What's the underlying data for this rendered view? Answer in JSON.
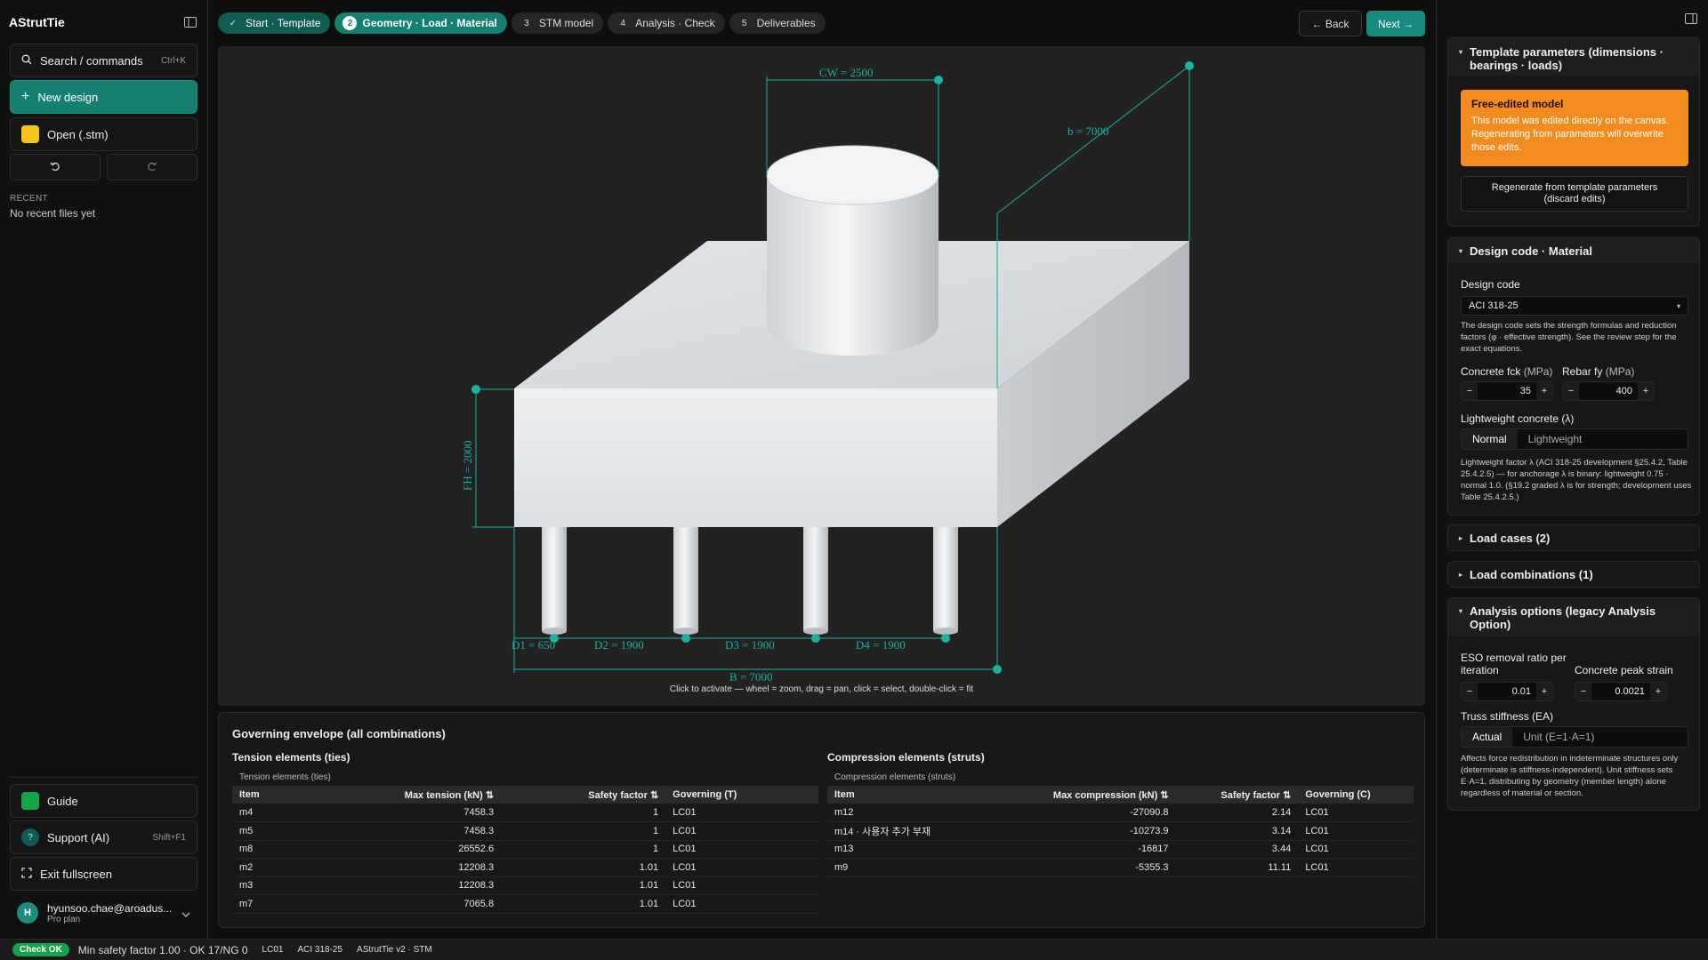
{
  "app": {
    "title": "AStrutTie"
  },
  "sidebar": {
    "search_label": "Search / commands",
    "search_shortcut": "Ctrl+K",
    "new_label": "New design",
    "open_label": "Open (.stm)",
    "recent_heading": "RECENT",
    "recent_empty": "No recent files yet",
    "guide_label": "Guide",
    "support_label": "Support (AI)",
    "support_shortcut": "Shift+F1",
    "fullscreen_label": "Exit fullscreen",
    "user_email": "hyunsoo.chae@aroadus...",
    "user_plan": "Pro plan",
    "user_initial": "H"
  },
  "steps": [
    {
      "num": "✓",
      "label": "Start · Template"
    },
    {
      "num": "2",
      "label": "Geometry · Load · Material"
    },
    {
      "num": "3",
      "label": "STM model"
    },
    {
      "num": "4",
      "label": "Analysis · Check"
    },
    {
      "num": "5",
      "label": "Deliverables"
    }
  ],
  "nav": {
    "back": "← Back",
    "next": "Next →"
  },
  "canvas": {
    "hint": "Click to activate — wheel = zoom, drag = pan, click = select, double-click = fit",
    "dims": {
      "cw": "CW = 2500",
      "b_depth": "b = 7000",
      "fh": "FH = 2000",
      "d1": "D1 = 650",
      "d2": "D2 = 1900",
      "d3": "D3 = 1900",
      "d4": "D4 = 1900",
      "b_width": "B = 7000"
    }
  },
  "results": {
    "title": "Governing envelope (all combinations)",
    "tension": {
      "heading": "Tension elements (ties)",
      "sub": "Tension elements (ties)",
      "cols": [
        "Item",
        "Max tension (kN) ⇅",
        "Safety factor ⇅",
        "Governing (T)"
      ],
      "rows": [
        [
          "m4",
          "7458.3",
          "1",
          "LC01"
        ],
        [
          "m5",
          "7458.3",
          "1",
          "LC01"
        ],
        [
          "m8",
          "26552.6",
          "1",
          "LC01"
        ],
        [
          "m2",
          "12208.3",
          "1.01",
          "LC01"
        ],
        [
          "m3",
          "12208.3",
          "1.01",
          "LC01"
        ],
        [
          "m7",
          "7065.8",
          "1.01",
          "LC01"
        ]
      ]
    },
    "compression": {
      "heading": "Compression elements (struts)",
      "sub": "Compression elements (struts)",
      "cols": [
        "Item",
        "Max compression (kN) ⇅",
        "Safety factor ⇅",
        "Governing (C)"
      ],
      "rows": [
        [
          "m12",
          "-27090.8",
          "2.14",
          "LC01"
        ],
        [
          "m14 · 사용자 추가 부재",
          "-10273.9",
          "3.14",
          "LC01"
        ],
        [
          "m13",
          "-16817",
          "3.44",
          "LC01"
        ],
        [
          "m9",
          "-5355.3",
          "11.11",
          "LC01"
        ]
      ]
    }
  },
  "right": {
    "template": {
      "title": "Template parameters (dimensions · bearings · loads)",
      "warn_title": "Free-edited model",
      "warn_body": "This model was edited directly on the canvas. Regenerating from parameters will overwrite those edits.",
      "regen": "Regenerate from template parameters (discard edits)"
    },
    "design": {
      "title": "Design code · Material",
      "code_label": "Design code",
      "code_value": "ACI 318-25",
      "code_note": "The design code sets the strength formulas and reduction factors (φ · effective strength). See the review step for the exact equations.",
      "fck_label": "Concrete fck",
      "fck_unit": "(MPa)",
      "fck_value": "35",
      "fy_label": "Rebar fy",
      "fy_unit": "(MPa)",
      "fy_value": "400",
      "lw_label": "Lightweight concrete (λ)",
      "lw_opt1": "Normal",
      "lw_opt2": "Lightweight",
      "lw_note": "Lightweight factor λ (ACI 318-25 development §25.4.2, Table 25.4.2.5) — for anchorage λ is binary: lightweight 0.75 · normal 1.0. (§19.2 graded λ is for strength; development uses Table 25.4.2.5.)"
    },
    "load_cases": "Load cases (2)",
    "load_combos": "Load combinations (1)",
    "analysis": {
      "title": "Analysis options (legacy Analysis Option)",
      "eso_label": "ESO removal ratio per iteration",
      "eso_value": "0.01",
      "strain_label": "Concrete peak strain",
      "strain_value": "0.0021",
      "ea_label": "Truss stiffness (EA)",
      "ea_opt1": "Actual",
      "ea_opt2": "Unit (E=1·A=1)",
      "ea_note": "Affects force redistribution in indeterminate structures only (determinate is stiffness-independent). Unit stiffness sets E·A=1, distributing by geometry (member length) alone regardless of material or section."
    }
  },
  "status": {
    "badge": "Check OK",
    "summary": "Min safety factor 1.00 · OK 17/NG 0",
    "combo": "LC01",
    "code": "ACI 318-25",
    "version": "AStrutTie v2 · STM"
  },
  "colors": {
    "accent": "#157f72",
    "dim": "#17b3a3",
    "warn": "#f28c1e",
    "ok": "#14a34a"
  }
}
